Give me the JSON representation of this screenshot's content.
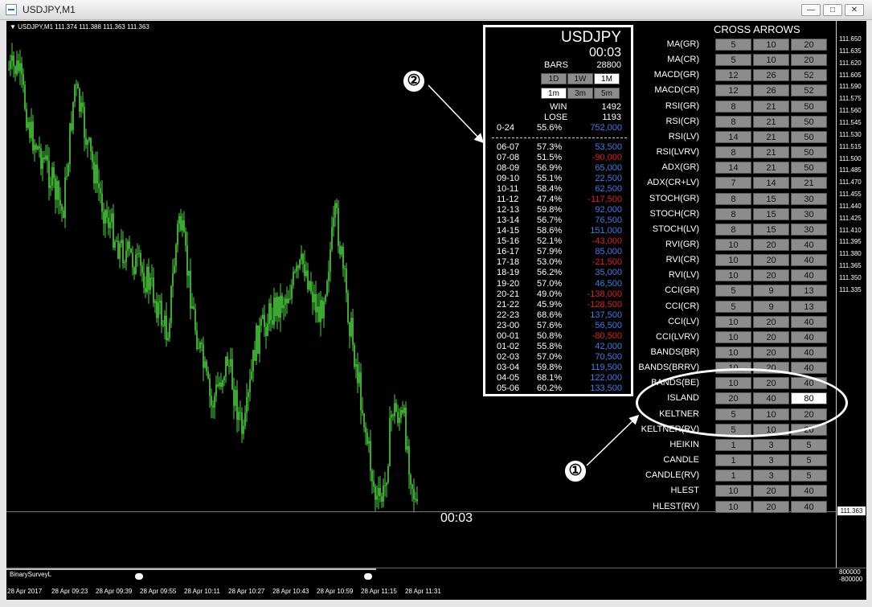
{
  "window": {
    "title": "USDJPY,M1",
    "buttons": [
      "—",
      "□",
      "✕"
    ]
  },
  "chart": {
    "header": "USDJPY,M1  111.374 111.388 111.363 111.363",
    "timer": "00:03",
    "price_labels": [
      "111.650",
      "111.635",
      "111.620",
      "111.605",
      "111.590",
      "111.575",
      "111.560",
      "111.545",
      "111.530",
      "111.515",
      "111.500",
      "111.485",
      "111.470",
      "111.455",
      "111.440",
      "111.425",
      "111.410",
      "111.395",
      "111.380",
      "111.365",
      "111.350",
      "111.335"
    ],
    "current_price": "111.363",
    "time_labels": [
      "28 Apr 2017",
      "28 Apr 09:23",
      "28 Apr 09:39",
      "28 Apr 09:55",
      "28 Apr 10:11",
      "28 Apr 10:27",
      "28 Apr 10:43",
      "28 Apr 10:59",
      "28 Apr 11:15",
      "28 Apr 11:31"
    ],
    "candle_color": "#4cd23f"
  },
  "stats": {
    "pair": "USDJPY",
    "clock": "00:03",
    "bars_label": "BARS",
    "bars_value": "28800",
    "period_buttons": [
      "1D",
      "1W",
      "1M"
    ],
    "period_selected": "1M",
    "tf_buttons": [
      "1m",
      "3m",
      "5m"
    ],
    "tf_selected": "1m",
    "win_label": "WIN",
    "win_value": "1492",
    "lose_label": "LOSE",
    "lose_value": "1193",
    "total": {
      "range": "0-24",
      "pct": "55.6%",
      "profit": "752,000"
    },
    "hours": [
      {
        "range": "06-07",
        "pct": "57.3%",
        "profit": "53,500"
      },
      {
        "range": "07-08",
        "pct": "51.5%",
        "profit": "-90,000"
      },
      {
        "range": "08-09",
        "pct": "56.9%",
        "profit": "65,000"
      },
      {
        "range": "09-10",
        "pct": "55.1%",
        "profit": "22,500"
      },
      {
        "range": "10-11",
        "pct": "58.4%",
        "profit": "62,500"
      },
      {
        "range": "11-12",
        "pct": "47.4%",
        "profit": "-117,500"
      },
      {
        "range": "12-13",
        "pct": "59.8%",
        "profit": "92,000"
      },
      {
        "range": "13-14",
        "pct": "56.7%",
        "profit": "76,500"
      },
      {
        "range": "14-15",
        "pct": "58.6%",
        "profit": "151,000"
      },
      {
        "range": "15-16",
        "pct": "52.1%",
        "profit": "-43,000"
      },
      {
        "range": "16-17",
        "pct": "57.9%",
        "profit": "85,000"
      },
      {
        "range": "17-18",
        "pct": "53.0%",
        "profit": "-21,500"
      },
      {
        "range": "18-19",
        "pct": "56.2%",
        "profit": "35,000"
      },
      {
        "range": "19-20",
        "pct": "57.0%",
        "profit": "46,500"
      },
      {
        "range": "20-21",
        "pct": "49.0%",
        "profit": "-138,000"
      },
      {
        "range": "21-22",
        "pct": "45.9%",
        "profit": "-128,500"
      },
      {
        "range": "22-23",
        "pct": "68.6%",
        "profit": "137,500"
      },
      {
        "range": "23-00",
        "pct": "57.6%",
        "profit": "56,500"
      },
      {
        "range": "00-01",
        "pct": "50.8%",
        "profit": "-80,500"
      },
      {
        "range": "01-02",
        "pct": "55.8%",
        "profit": "42,000"
      },
      {
        "range": "02-03",
        "pct": "57.0%",
        "profit": "70,500"
      },
      {
        "range": "03-04",
        "pct": "59.8%",
        "profit": "119,500"
      },
      {
        "range": "04-05",
        "pct": "68.1%",
        "profit": "122,000"
      },
      {
        "range": "05-06",
        "pct": "60.2%",
        "profit": "133,500"
      }
    ],
    "positive_color": "#3f7de8",
    "negative_color": "#e02020"
  },
  "cross_arrows": {
    "title": "CROSS ARROWS",
    "rows": [
      {
        "label": "MA(GR)",
        "values": [
          "5",
          "10",
          "20"
        ]
      },
      {
        "label": "MA(CR)",
        "values": [
          "5",
          "10",
          "20"
        ]
      },
      {
        "label": "MACD(GR)",
        "values": [
          "12",
          "26",
          "52"
        ]
      },
      {
        "label": "MACD(CR)",
        "values": [
          "12",
          "26",
          "52"
        ]
      },
      {
        "label": "RSI(GR)",
        "values": [
          "8",
          "21",
          "50"
        ]
      },
      {
        "label": "RSI(CR)",
        "values": [
          "8",
          "21",
          "50"
        ]
      },
      {
        "label": "RSI(LV)",
        "values": [
          "14",
          "21",
          "50"
        ]
      },
      {
        "label": "RSI(LVRV)",
        "values": [
          "8",
          "21",
          "50"
        ]
      },
      {
        "label": "ADX(GR)",
        "values": [
          "14",
          "21",
          "50"
        ]
      },
      {
        "label": "ADX(CR+LV)",
        "values": [
          "7",
          "14",
          "21"
        ]
      },
      {
        "label": "STOCH(GR)",
        "values": [
          "8",
          "15",
          "30"
        ]
      },
      {
        "label": "STOCH(CR)",
        "values": [
          "8",
          "15",
          "30"
        ]
      },
      {
        "label": "STOCH(LV)",
        "values": [
          "8",
          "15",
          "30"
        ]
      },
      {
        "label": "RVI(GR)",
        "values": [
          "10",
          "20",
          "40"
        ]
      },
      {
        "label": "RVI(CR)",
        "values": [
          "10",
          "20",
          "40"
        ]
      },
      {
        "label": "RVI(LV)",
        "values": [
          "10",
          "20",
          "40"
        ]
      },
      {
        "label": "CCI(GR)",
        "values": [
          "5",
          "9",
          "13"
        ]
      },
      {
        "label": "CCI(CR)",
        "values": [
          "5",
          "9",
          "13"
        ]
      },
      {
        "label": "CCI(LV)",
        "values": [
          "10",
          "20",
          "40"
        ]
      },
      {
        "label": "CCI(LVRV)",
        "values": [
          "10",
          "20",
          "40"
        ]
      },
      {
        "label": "BANDS(BR)",
        "values": [
          "10",
          "20",
          "40"
        ]
      },
      {
        "label": "BANDS(BRRV)",
        "values": [
          "10",
          "20",
          "40"
        ]
      },
      {
        "label": "BANDS(BE)",
        "values": [
          "10",
          "20",
          "40"
        ]
      },
      {
        "label": "ISLAND",
        "values": [
          "20",
          "40",
          "80"
        ],
        "selected": 2
      },
      {
        "label": "KELTNER",
        "values": [
          "5",
          "10",
          "20"
        ]
      },
      {
        "label": "KELTNER(RV)",
        "values": [
          "5",
          "10",
          "20"
        ]
      },
      {
        "label": "HEIKIN",
        "values": [
          "1",
          "3",
          "5"
        ]
      },
      {
        "label": "CANDLE",
        "values": [
          "1",
          "3",
          "5"
        ]
      },
      {
        "label": "CANDLE(RV)",
        "values": [
          "1",
          "3",
          "5"
        ]
      },
      {
        "label": "HLEST",
        "values": [
          "10",
          "20",
          "40"
        ]
      },
      {
        "label": "HLEST(RV)",
        "values": [
          "10",
          "20",
          "40"
        ]
      }
    ]
  },
  "annotations": {
    "marker1": "①",
    "marker2": "②"
  },
  "indicator": {
    "name": "BinarySurveyL",
    "values": [
      "800000",
      "-800000"
    ]
  }
}
